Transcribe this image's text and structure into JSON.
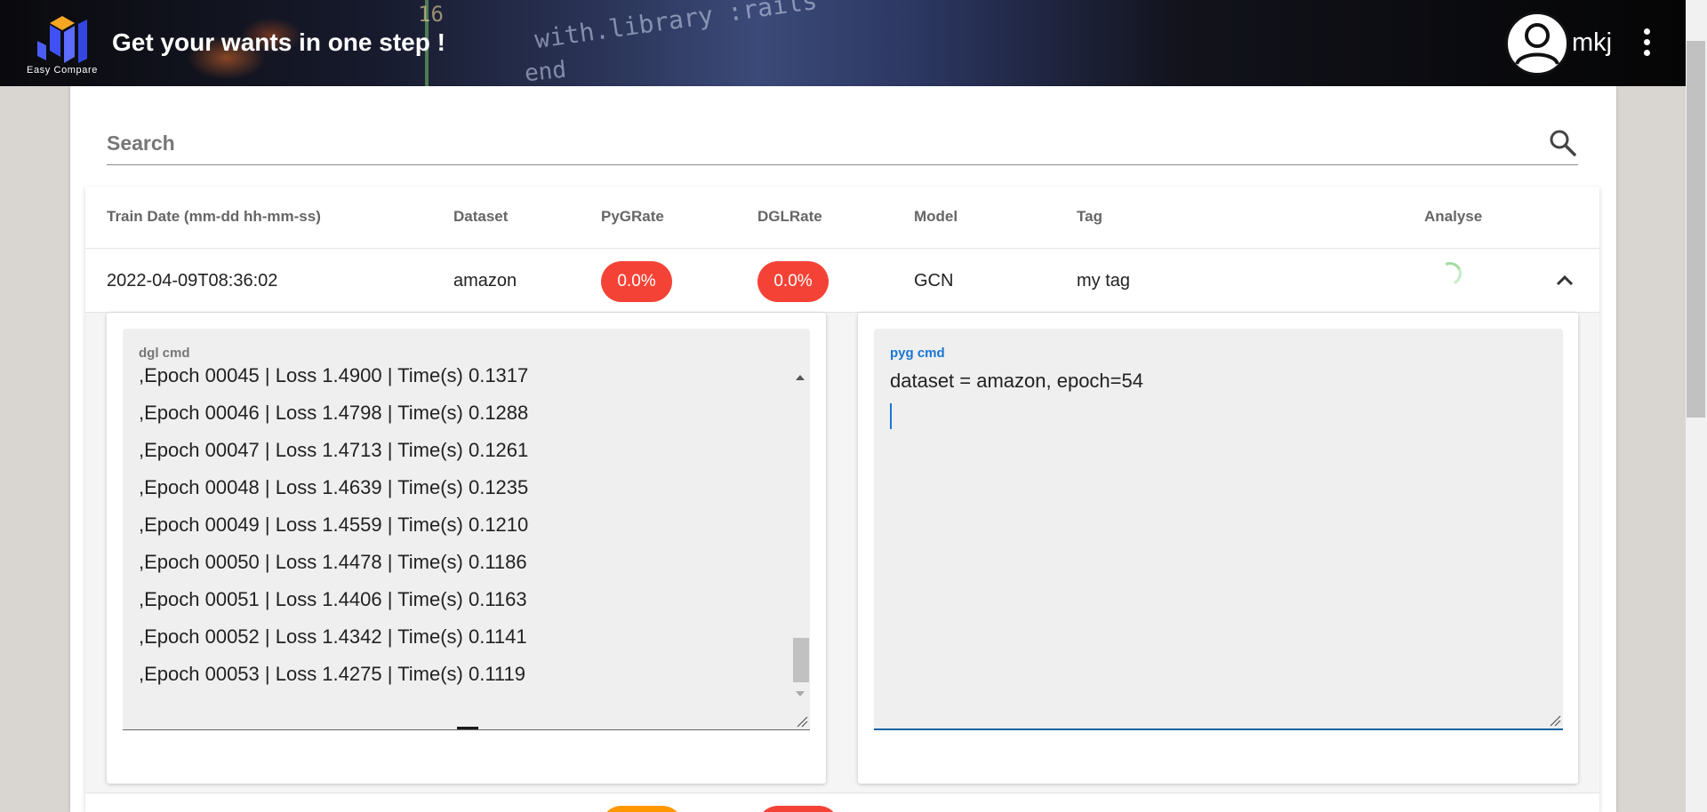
{
  "header": {
    "title": "Get your wants in one step !",
    "logo_caption": "Easy Compare",
    "username": "mkj",
    "background_code_text": [
      "with.library :rails",
      "end",
      "16"
    ]
  },
  "search": {
    "placeholder": "Search",
    "value": ""
  },
  "table": {
    "columns": [
      "Train Date (mm-dd hh-mm-ss)",
      "Dataset",
      "PyGRate",
      "DGLRate",
      "Model",
      "Tag",
      "Analyse"
    ],
    "rows": [
      {
        "train_date": "2022-04-09T08:36:02",
        "dataset": "amazon",
        "pyg_rate": "0.0%",
        "dgl_rate": "0.0%",
        "model": "GCN",
        "tag": "my tag",
        "expanded": true
      }
    ]
  },
  "detail": {
    "dgl_cmd": {
      "label": "dgl cmd",
      "lines": [
        ",Epoch 00045 | Loss 1.4900 | Time(s) 0.1317",
        ",Epoch 00046 | Loss 1.4798 | Time(s) 0.1288",
        ",Epoch 00047 | Loss 1.4713 | Time(s) 0.1261",
        ",Epoch 00048 | Loss 1.4639 | Time(s) 0.1235",
        ",Epoch 00049 | Loss 1.4559 | Time(s) 0.1210",
        ",Epoch 00050 | Loss 1.4478 | Time(s) 0.1186",
        ",Epoch 00051 | Loss 1.4406 | Time(s) 0.1163",
        ",Epoch 00052 | Loss 1.4342 | Time(s) 0.1141",
        ",Epoch 00053 | Loss 1.4275 | Time(s) 0.1119"
      ]
    },
    "pyg_cmd": {
      "label": "pyg cmd",
      "value": "dataset = amazon, epoch=54"
    }
  },
  "colors": {
    "rate_badge": "#f44336",
    "second_row_pyg_badge": "#ff9800",
    "focus_accent": "#1976d2"
  },
  "icons": {
    "search": "search-icon",
    "more": "more-vert-icon",
    "expand": "chevron-up-icon",
    "avatar": "account-circle-icon"
  }
}
